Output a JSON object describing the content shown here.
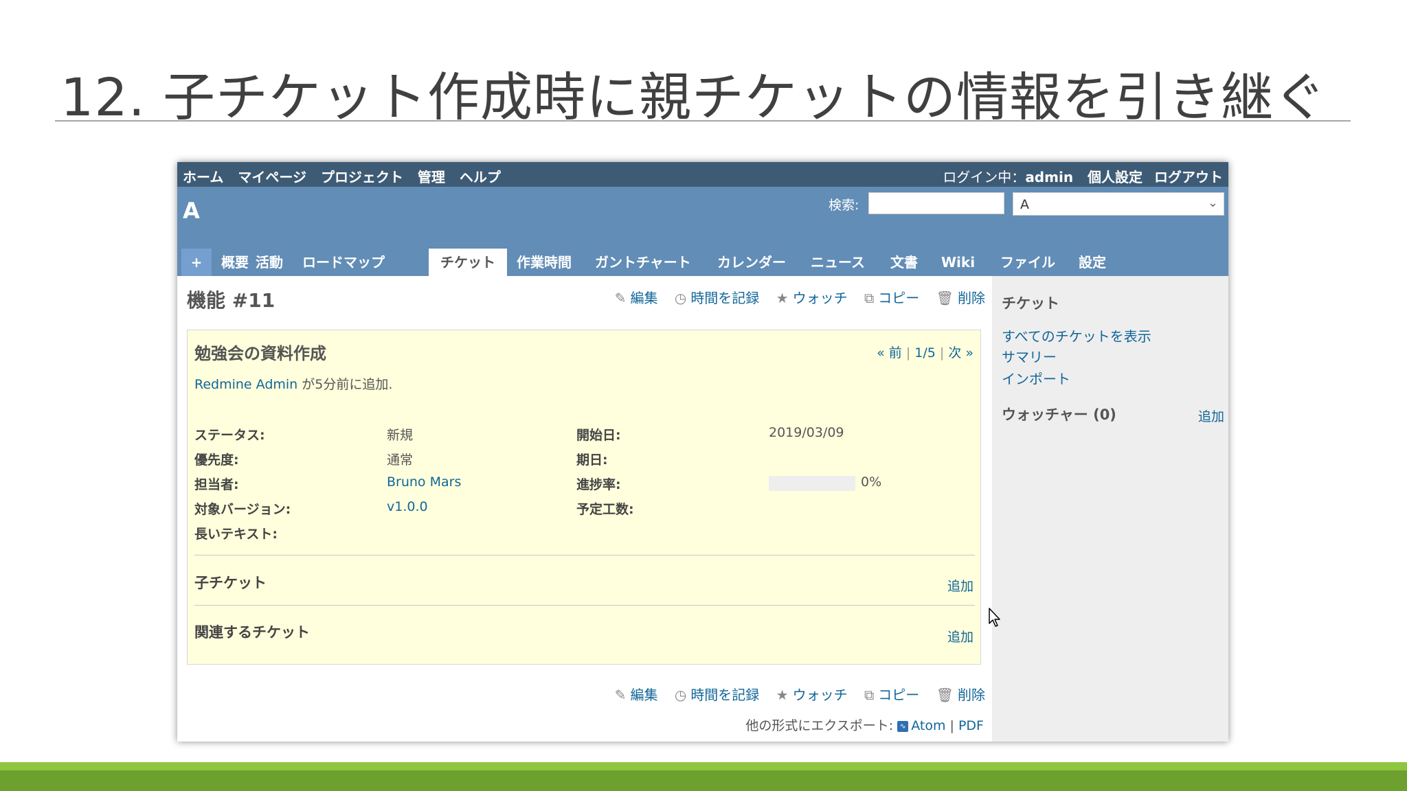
{
  "slide": {
    "title": "12. 子チケット作成時に親チケットの情報を引き継ぐ"
  },
  "top_menu": {
    "left": [
      "ホーム",
      "マイページ",
      "プロジェクト",
      "管理",
      "ヘルプ"
    ],
    "logged_in_label": "ログイン中：",
    "user": "admin",
    "my_account": "個人設定",
    "logout": "ログアウト"
  },
  "header": {
    "project": "A",
    "search_label": "検索:",
    "search_value": "",
    "project_select": "A"
  },
  "tabs": [
    "+",
    "概要",
    "活動",
    "ロードマップ",
    "チケット",
    "作業時間",
    "ガントチャート",
    "カレンダー",
    "ニュース",
    "文書",
    "Wiki",
    "ファイル",
    "設定"
  ],
  "selected_tab": "チケット",
  "issue": {
    "heading": "機能 #11",
    "actions": {
      "edit": "編集",
      "log_time": "時間を記録",
      "watch": "ウォッチ",
      "copy": "コピー",
      "delete": "削除"
    },
    "subject": "勉強会の資料作成",
    "pager": {
      "prev": "« 前",
      "position": "1/5",
      "next": "次 »"
    },
    "author_link": "Redmine Admin",
    "author_suffix": " が5分前に追加.",
    "attributes": {
      "status_label": "ステータス:",
      "status": "新規",
      "priority_label": "優先度:",
      "priority": "通常",
      "assignee_label": "担当者:",
      "assignee": "Bruno Mars",
      "version_label": "対象バージョン:",
      "version": "v1.0.0",
      "long_text_label": "長いテキスト:",
      "start_label": "開始日:",
      "start_date": "2019/03/09",
      "due_label": "期日:",
      "done_label": "進捗率:",
      "done_ratio": "0%",
      "done_ratio_value": 0,
      "estimated_label": "予定工数:"
    },
    "subtasks": {
      "title": "子チケット",
      "add": "追加"
    },
    "relations": {
      "title": "関連するチケット",
      "add": "追加"
    },
    "export": {
      "label": "他の形式にエクスポート:",
      "atom": "Atom",
      "pdf": "PDF"
    }
  },
  "sidebar": {
    "issues_title": "チケット",
    "links": [
      "すべてのチケットを表示",
      "サマリー",
      "インポート"
    ],
    "watchers_title": "ウォッチャー (0)",
    "watchers_add": "追加"
  },
  "colors": {
    "header": "#628db6",
    "top_menu": "#3e5b76",
    "box": "#ffffdd",
    "link": "#1166aa",
    "band": "#6ea02f"
  }
}
